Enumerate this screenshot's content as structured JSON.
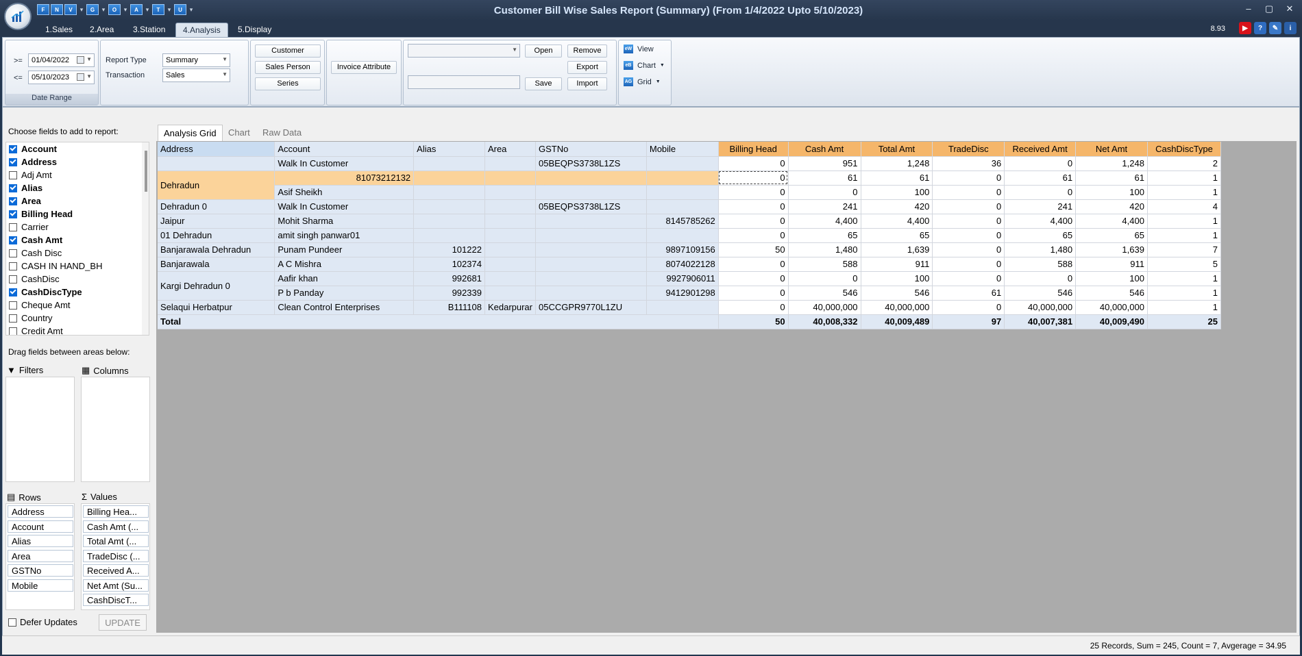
{
  "window": {
    "title": "Customer Bill Wise Sales Report (Summary) (From 1/4/2022 Upto 5/10/2023)",
    "version": "8.93",
    "controls": [
      "minimize-icon",
      "maximize-icon",
      "close-icon"
    ]
  },
  "quick_access": [
    {
      "label": "F",
      "icon": "qa-f-icon"
    },
    {
      "label": "N",
      "icon": "qa-n-icon"
    },
    {
      "label": "V",
      "icon": "qa-v-icon"
    },
    {
      "label": "G",
      "icon": "qa-g-icon"
    },
    {
      "label": "O",
      "icon": "qa-o-icon"
    },
    {
      "label": "A",
      "icon": "qa-a-icon"
    },
    {
      "label": "T",
      "icon": "qa-t-icon"
    },
    {
      "label": "U",
      "icon": "qa-u-icon"
    }
  ],
  "tabs": [
    "1.Sales",
    "2.Area",
    "3.Station",
    "4.Analysis",
    "5.Display"
  ],
  "active_tab": "4.Analysis",
  "ribbon": {
    "date_range": {
      "from_op": ">=",
      "from": "01/04/2022",
      "to_op": "<=",
      "to": "05/10/2023",
      "label": "Date Range"
    },
    "report_type_label": "Report Type",
    "report_type_value": "Summary",
    "transaction_label": "Transaction",
    "transaction_value": "Sales",
    "customer_btn": "Customer",
    "sales_person_btn": "Sales Person",
    "series_btn": "Series",
    "invoice_attr_btn": "Invoice Attribute",
    "open_btn": "Open",
    "remove_btn": "Remove",
    "export_btn": "Export",
    "save_btn": "Save",
    "import_btn": "Import",
    "view_label": "View",
    "chart_label": "Chart",
    "grid_label": "Grid"
  },
  "left_panel": {
    "choose_title": "Choose fields to add to report:",
    "fields": [
      {
        "label": "Account",
        "checked": true
      },
      {
        "label": "Address",
        "checked": true
      },
      {
        "label": "Adj Amt",
        "checked": false
      },
      {
        "label": "Alias",
        "checked": true
      },
      {
        "label": "Area",
        "checked": true
      },
      {
        "label": "Billing Head",
        "checked": true
      },
      {
        "label": "Carrier",
        "checked": false
      },
      {
        "label": "Cash Amt",
        "checked": true
      },
      {
        "label": "Cash Disc",
        "checked": false
      },
      {
        "label": "CASH IN HAND_BH",
        "checked": false
      },
      {
        "label": "CashDisc",
        "checked": false
      },
      {
        "label": "CashDiscType",
        "checked": true
      },
      {
        "label": "Cheque Amt",
        "checked": false
      },
      {
        "label": "Country",
        "checked": false
      },
      {
        "label": "Credit Amt",
        "checked": false
      }
    ],
    "drag_title": "Drag fields between areas below:",
    "filters_label": "Filters",
    "columns_label": "Columns",
    "rows_label": "Rows",
    "values_label": "Values",
    "rows": [
      "Address",
      "Account",
      "Alias",
      "Area",
      "GSTNo",
      "Mobile"
    ],
    "values": [
      "Billing Hea...",
      "Cash Amt (...",
      "Total Amt (...",
      "TradeDisc (...",
      "Received A...",
      "Net Amt (Su...",
      "CashDiscT..."
    ],
    "defer_label": "Defer Updates",
    "update_btn": "UPDATE"
  },
  "grid_tabs": [
    "Analysis Grid",
    "Chart",
    "Raw Data"
  ],
  "grid": {
    "row_headers": [
      "Address",
      "Account",
      "Alias",
      "Area",
      "GSTNo",
      "Mobile"
    ],
    "value_headers": [
      "Billing Head",
      "Cash Amt",
      "Total Amt",
      "TradeDisc",
      "Received Amt",
      "Net Amt",
      "CashDiscType"
    ],
    "rows": [
      {
        "address": "",
        "account": "Walk In Customer",
        "alias": "",
        "area": "",
        "gst": "05BEQPS3738L1ZS",
        "mobile": "",
        "v": [
          "0",
          "951",
          "1,248",
          "36",
          "0",
          "1,248",
          "2"
        ]
      },
      {
        "address": "Dehradun",
        "account": "81073212132",
        "alias": "",
        "area": "",
        "gst": "",
        "mobile": "",
        "v": [
          "0",
          "61",
          "61",
          "0",
          "61",
          "61",
          "1"
        ]
      },
      {
        "address": "",
        "account": "Asif Sheikh",
        "alias": "",
        "area": "",
        "gst": "",
        "mobile": "",
        "v": [
          "0",
          "0",
          "100",
          "0",
          "0",
          "100",
          "1"
        ]
      },
      {
        "address": "Dehradun 0",
        "account": "Walk In Customer",
        "alias": "",
        "area": "",
        "gst": "05BEQPS3738L1ZS",
        "mobile": "",
        "v": [
          "0",
          "241",
          "420",
          "0",
          "241",
          "420",
          "4"
        ]
      },
      {
        "address": "Jaipur",
        "account": "Mohit Sharma",
        "alias": "",
        "area": "",
        "gst": "",
        "mobile": "8145785262",
        "v": [
          "0",
          "4,400",
          "4,400",
          "0",
          "4,400",
          "4,400",
          "1"
        ]
      },
      {
        "address": "01 Dehradun",
        "account": "amit singh panwar01",
        "alias": "",
        "area": "",
        "gst": "",
        "mobile": "",
        "v": [
          "0",
          "65",
          "65",
          "0",
          "65",
          "65",
          "1"
        ]
      },
      {
        "address": "Banjarawala Dehradun",
        "account": "Punam Pundeer",
        "alias": "101222",
        "area": "",
        "gst": "",
        "mobile": "9897109156",
        "v": [
          "50",
          "1,480",
          "1,639",
          "0",
          "1,480",
          "1,639",
          "7"
        ]
      },
      {
        "address": "Banjarawala",
        "account": "A C Mishra",
        "alias": "102374",
        "area": "",
        "gst": "",
        "mobile": "8074022128",
        "v": [
          "0",
          "588",
          "911",
          "0",
          "588",
          "911",
          "5"
        ]
      },
      {
        "address": "Kargi Dehradun 0",
        "account": "Aafir khan",
        "alias": "992681",
        "area": "",
        "gst": "",
        "mobile": "9927906011",
        "v": [
          "0",
          "0",
          "100",
          "0",
          "0",
          "100",
          "1"
        ]
      },
      {
        "address": "",
        "account": "P b Panday",
        "alias": "992339",
        "area": "",
        "gst": "",
        "mobile": "9412901298",
        "v": [
          "0",
          "546",
          "546",
          "61",
          "546",
          "546",
          "1"
        ]
      },
      {
        "address": "Selaqui Herbatpur",
        "account": "Clean Control Enterprises",
        "alias": "B111108",
        "area": "Kedarpurar",
        "gst": "05CCGPR9770L1ZU",
        "mobile": "",
        "v": [
          "0",
          "40,000,000",
          "40,000,000",
          "0",
          "40,000,000",
          "40,000,000",
          "1"
        ]
      }
    ],
    "total_label": "Total",
    "totals": [
      "50",
      "40,008,332",
      "40,009,489",
      "97",
      "40,007,381",
      "40,009,490",
      "25"
    ]
  },
  "status": "25 Records, Sum = 245, Count = 7, Avgerage = 34.95"
}
